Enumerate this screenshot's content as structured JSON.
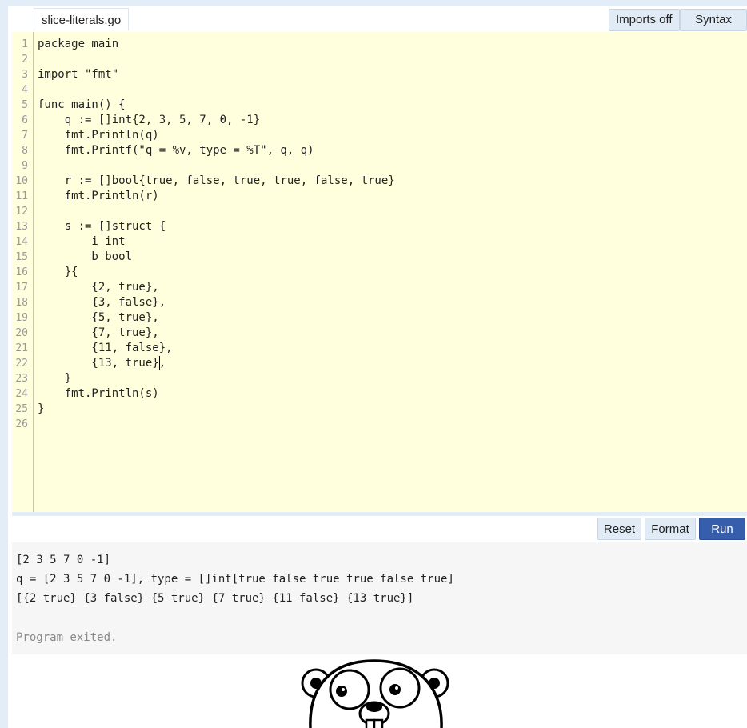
{
  "editor": {
    "filename": "slice-literals.go",
    "imports_label": "Imports off",
    "syntax_label": "Syntax off",
    "lines": [
      "package main",
      "",
      "import \"fmt\"",
      "",
      "func main() {",
      "    q := []int{2, 3, 5, 7, 0, -1}",
      "    fmt.Println(q)",
      "    fmt.Printf(\"q = %v, type = %T\", q, q)",
      "",
      "    r := []bool{true, false, true, true, false, true}",
      "    fmt.Println(r)",
      "",
      "    s := []struct {",
      "        i int",
      "        b bool",
      "    }{",
      "        {2, true},",
      "        {3, false},",
      "        {5, true},",
      "        {7, true},",
      "        {11, false},",
      "        {13, true},",
      "    }",
      "    fmt.Println(s)",
      "}",
      ""
    ],
    "line_numbers": [
      "1",
      "2",
      "3",
      "4",
      "5",
      "6",
      "7",
      "8",
      "9",
      "10",
      "11",
      "12",
      "13",
      "14",
      "15",
      "16",
      "17",
      "18",
      "19",
      "20",
      "21",
      "22",
      "23",
      "24",
      "25",
      "26"
    ]
  },
  "controls": {
    "reset_label": "Reset",
    "format_label": "Format",
    "run_label": "Run"
  },
  "output": {
    "lines": [
      "[2 3 5 7 0 -1]",
      "q = [2 3 5 7 0 -1], type = []int[true false true true false true]",
      "[{2 true} {3 false} {5 true} {7 true} {11 false} {13 true}]"
    ],
    "exit_message": "Program exited."
  },
  "colors": {
    "editor_bg": "#ffffdd",
    "run_button": "#375eab",
    "button_bg": "#e0ebf5",
    "frame": "#e3edf7"
  }
}
